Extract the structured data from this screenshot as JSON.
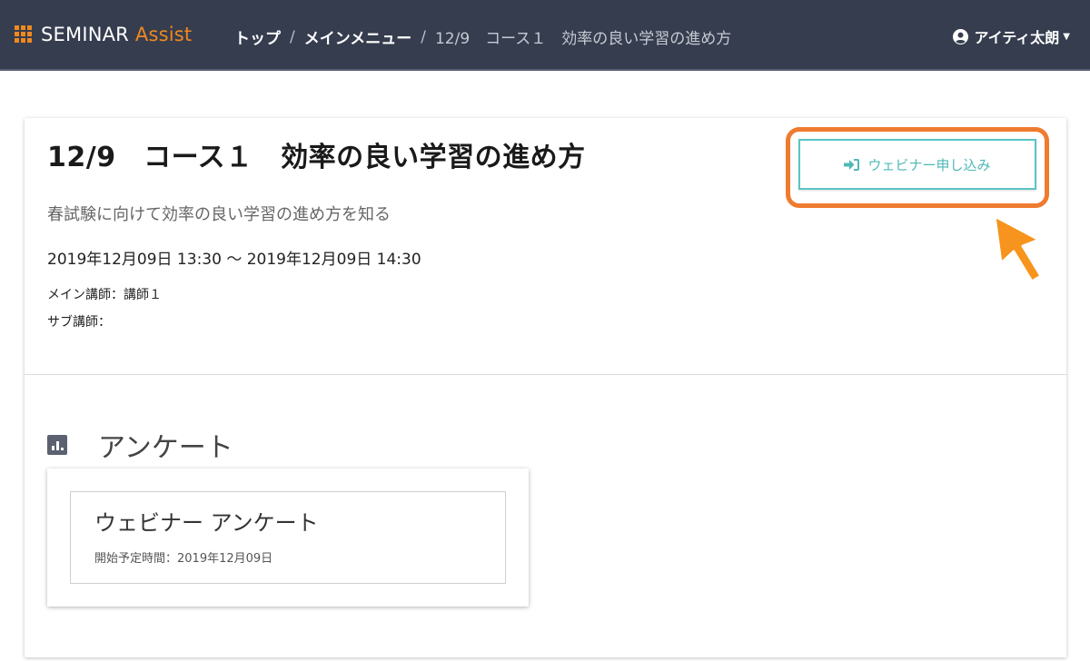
{
  "header": {
    "brand_main": "SEMINAR",
    "brand_accent": "Assist",
    "breadcrumb": {
      "top": "トップ",
      "separator": "/",
      "main_menu": "メインメニュー",
      "current": "12/9　コース１　効率の良い学習の進め方"
    },
    "user_name": "アイティ太朗",
    "user_icon": "user-circle-icon"
  },
  "course": {
    "title": "12/9　コース１　効率の良い学習の進め方",
    "description": "春試験に向けて効率の良い学習の進め方を知る",
    "datetime": "2019年12月09日 13:30 ～ 2019年12月09日 14:30",
    "main_instructor": "メイン講師：講師１",
    "sub_instructor": "サブ講師：",
    "apply_button_label": "ウェビナー申し込み",
    "apply_button_icon": "sign-in-icon"
  },
  "survey_section": {
    "heading": "アンケート",
    "icon": "bar-chart-icon",
    "items": [
      {
        "title": "ウェビナー アンケート",
        "start": "開始予定時間：2019年12月09日"
      }
    ]
  },
  "colors": {
    "navbar": "#363d4f",
    "brand_accent": "#f0891e",
    "button_teal": "#5bc4c4",
    "highlight_orange": "#ef7b2f",
    "arrow_orange": "#f7941d"
  }
}
